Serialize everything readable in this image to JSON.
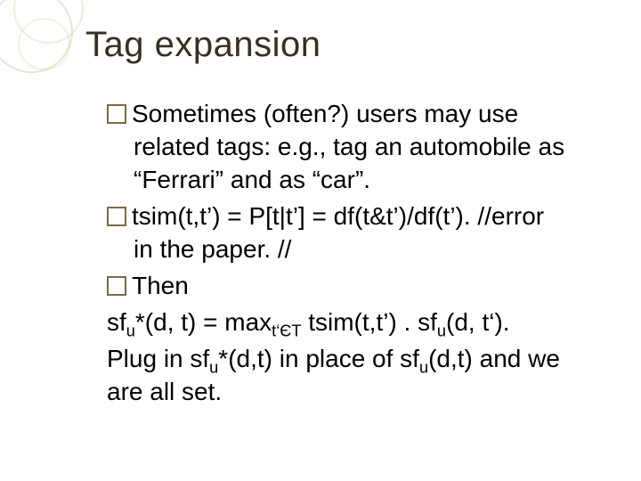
{
  "title": "Tag expansion",
  "bullets": {
    "b1": "Sometimes (often?) users may use related tags: e.g., tag an automobile as “Ferrari” and as “car”.",
    "b2_lead": "tsim(t,t’) = P[t|t’] = df(t&t’)/df(t’). //error in the paper. //",
    "b3": "Then"
  },
  "lines": {
    "l1_pre": "sf",
    "l1_sub1": "u",
    "l1_mid1": "*(d, t) = max",
    "l1_sub2": "t‘ЄT",
    "l1_mid2": " tsim(t,t’) . sf",
    "l1_sub3": "u",
    "l1_post": "(d, t‘).",
    "l2_pre": "Plug in sf",
    "l2_sub1": "u",
    "l2_mid": "*(d,t) in place of sf",
    "l2_sub2": "u",
    "l2_post": "(d,t) and we are all set."
  }
}
